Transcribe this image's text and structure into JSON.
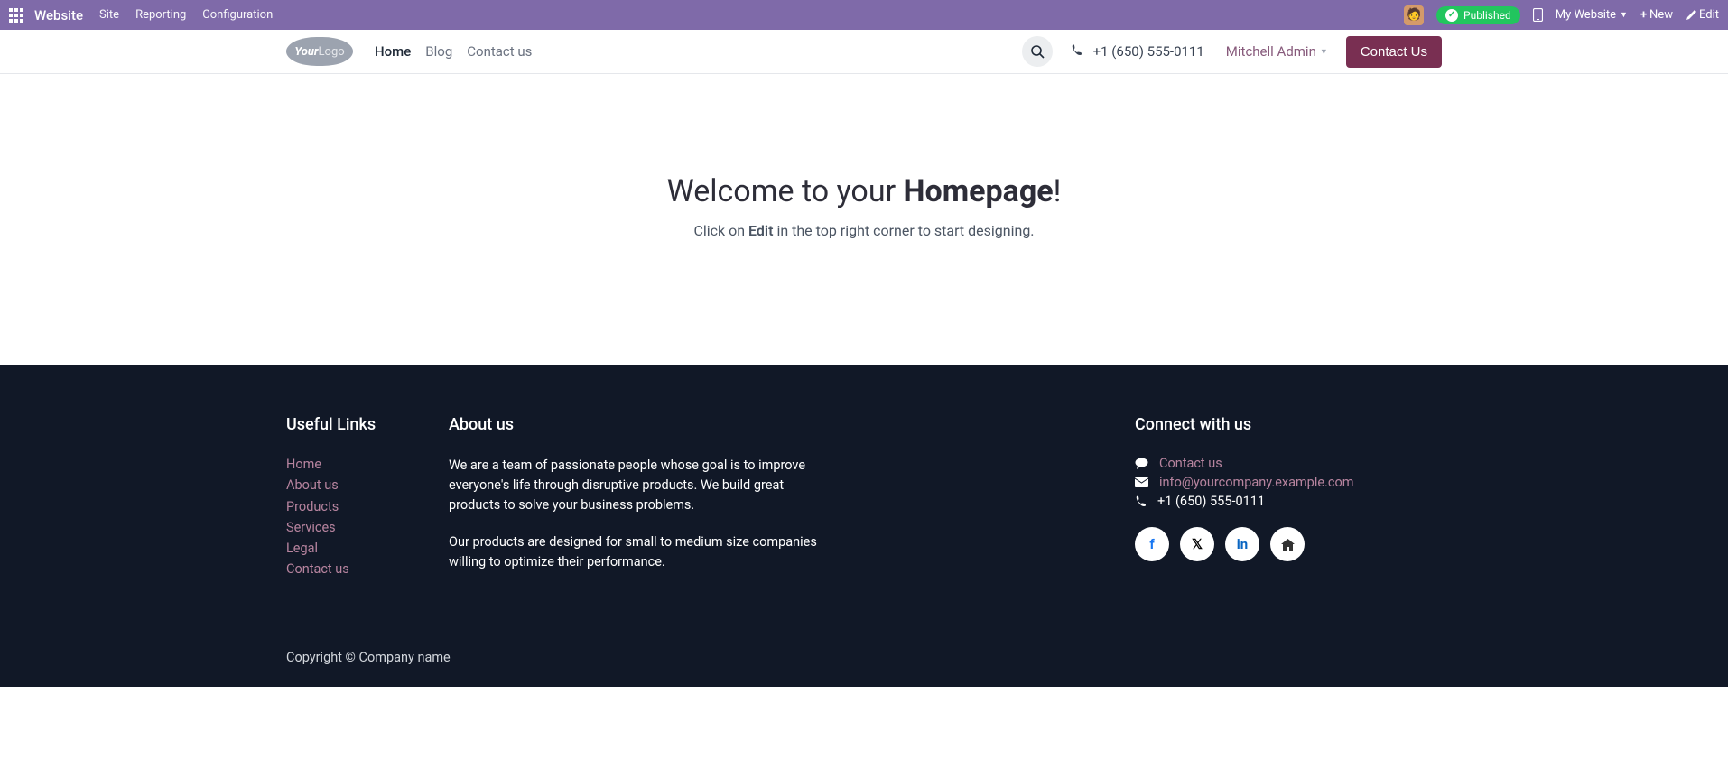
{
  "topbar": {
    "brand": "Website",
    "menu": [
      "Site",
      "Reporting",
      "Configuration"
    ],
    "published": "Published",
    "my_website": "My Website",
    "new": "New",
    "edit": "Edit"
  },
  "sitebar": {
    "logo_your": "Your",
    "logo_logo": "Logo",
    "nav": [
      "Home",
      "Blog",
      "Contact us"
    ],
    "phone": "+1 (650) 555-0111",
    "user": "Mitchell Admin",
    "contact_btn": "Contact Us"
  },
  "hero": {
    "title_pre": "Welcome to your ",
    "title_bold": "Homepage",
    "title_post": "!",
    "sub_pre": "Click on ",
    "sub_bold": "Edit",
    "sub_post": " in the top right corner to start designing."
  },
  "footer": {
    "useful_title": "Useful Links",
    "useful_links": [
      "Home",
      "About us",
      "Products",
      "Services",
      "Legal",
      "Contact us"
    ],
    "about_title": "About us",
    "about_p1": "We are a team of passionate people whose goal is to improve everyone's life through disruptive products. We build great products to solve your business problems.",
    "about_p2": "Our products are designed for small to medium size companies willing to optimize their performance.",
    "connect_title": "Connect with us",
    "contact_link": "Contact us",
    "email": "info@yourcompany.example.com",
    "phone": "+1 (650) 555-0111",
    "copyright": "Copyright © Company name"
  }
}
